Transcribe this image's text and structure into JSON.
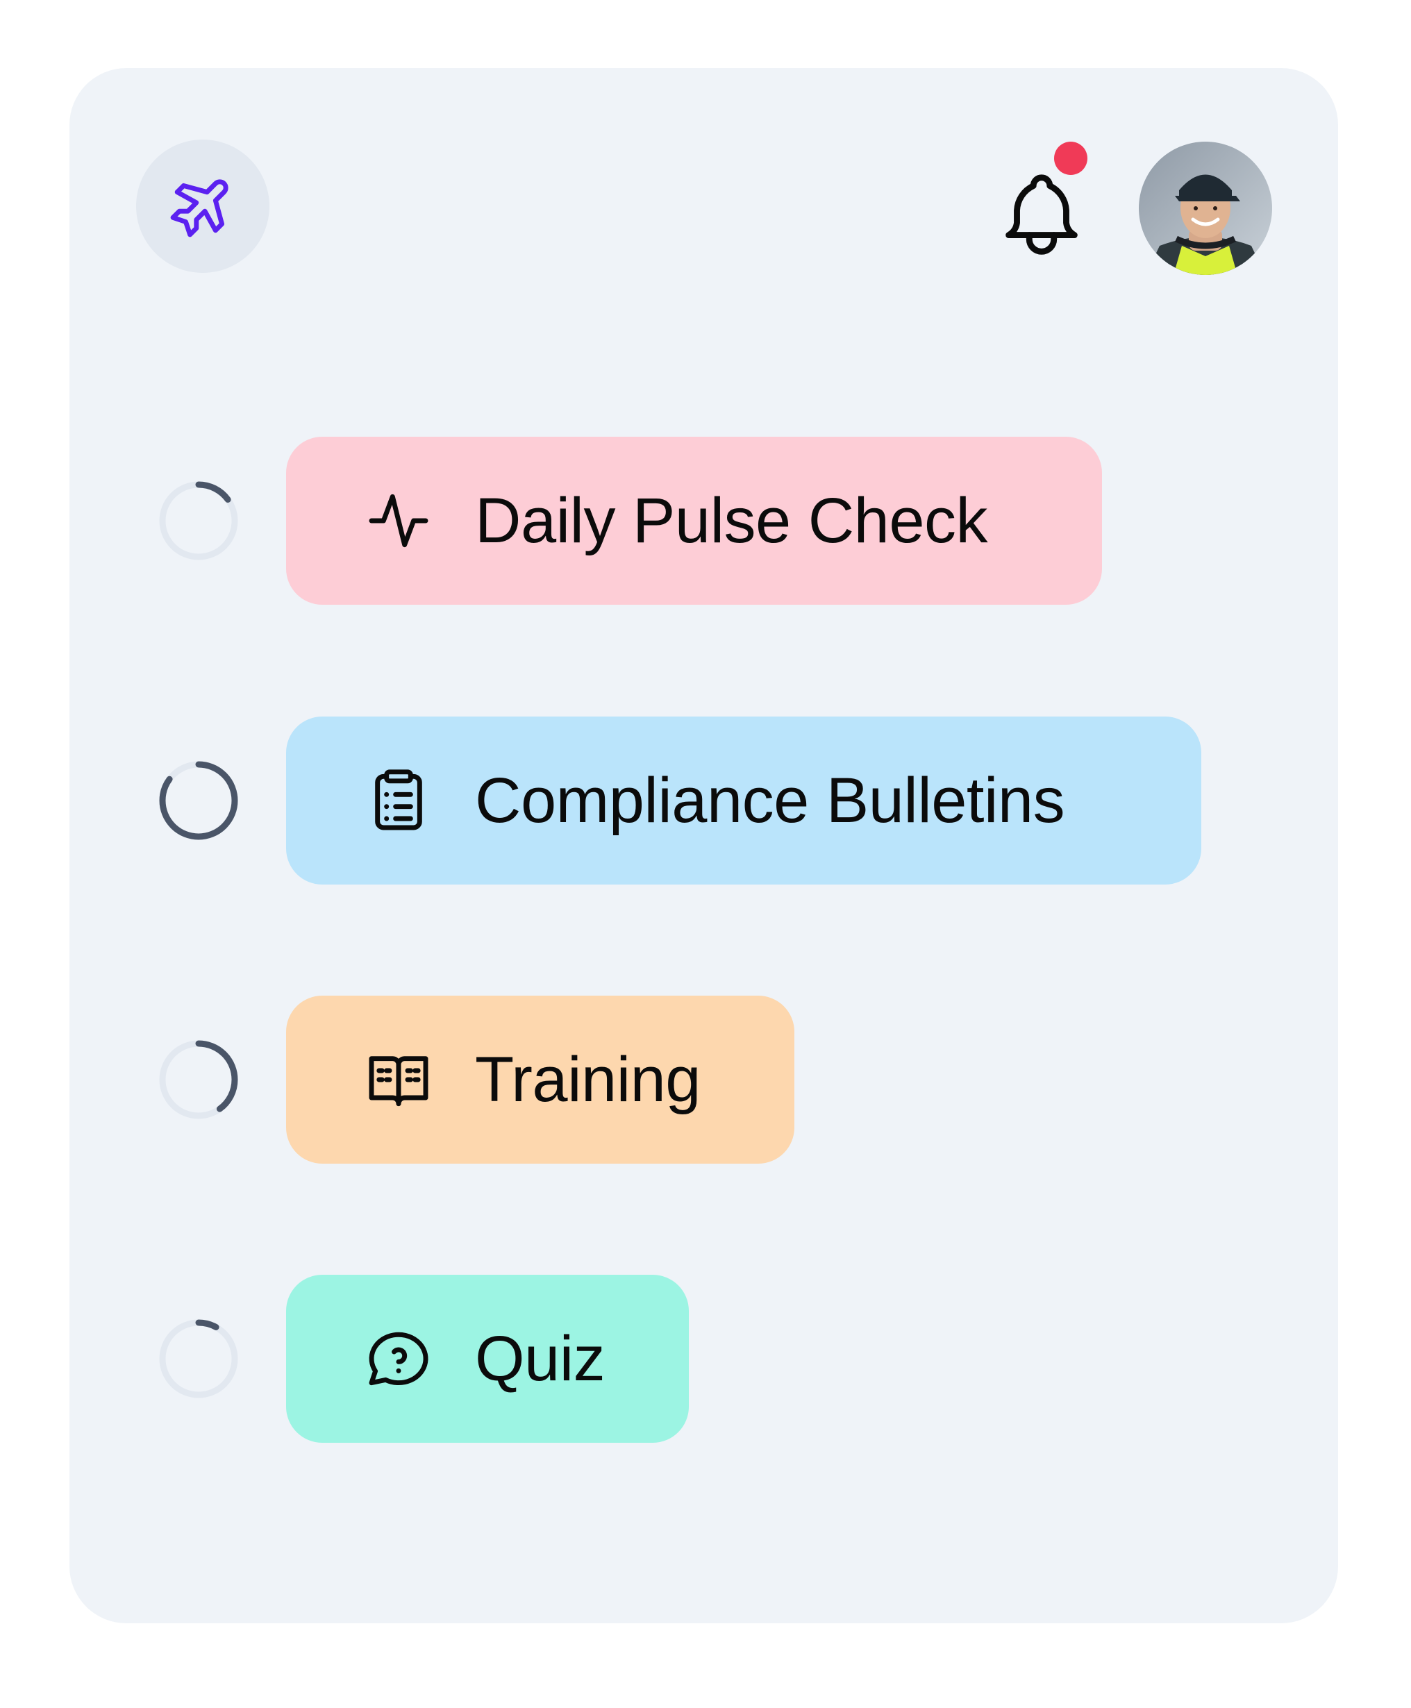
{
  "header": {
    "app_icon": "airplane-icon",
    "notification_icon": "bell-icon",
    "notification_unread": true,
    "avatar": "user-avatar-photo"
  },
  "colors": {
    "card_background": "#eff3f8",
    "accent": "#5b21f0",
    "notification_dot": "#f03a57",
    "progress_track": "#e2e8f0",
    "progress_fill": "#4a5568"
  },
  "tasks": [
    {
      "label": "Daily Pulse Check",
      "icon": "pulse-icon",
      "color": "#fdcdd6",
      "progress": 0.15
    },
    {
      "label": "Compliance Bulletins",
      "icon": "clipboard-list-icon",
      "color": "#bae4fb",
      "progress": 0.85
    },
    {
      "label": "Training",
      "icon": "open-book-icon",
      "color": "#fdd7ae",
      "progress": 0.4
    },
    {
      "label": "Quiz",
      "icon": "question-bubble-icon",
      "color": "#9cf4e3",
      "progress": 0.08
    }
  ]
}
